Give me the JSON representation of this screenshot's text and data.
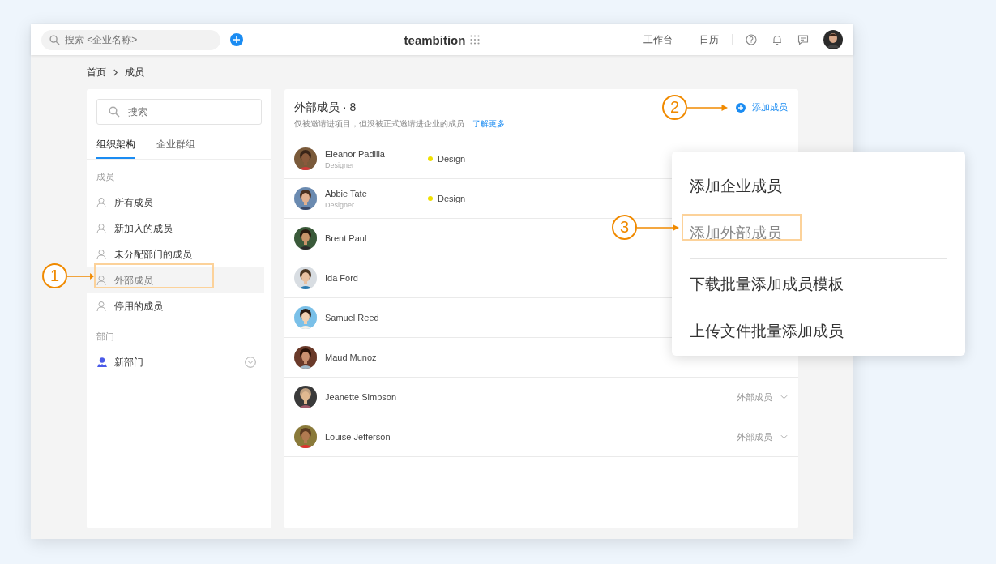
{
  "topbar": {
    "search": {
      "placeholder": "搜索 <企业名称>"
    },
    "logo": "teambition",
    "nav": [
      "工作台",
      "日历"
    ]
  },
  "breadcrumb": [
    "首页",
    "成员"
  ],
  "sidebar": {
    "search": {
      "placeholder": "搜索"
    },
    "tabs": [
      {
        "label": "组织架构",
        "selected": true
      },
      {
        "label": "企业群组",
        "selected": false
      }
    ],
    "sections": [
      {
        "heading": "成员",
        "items": [
          {
            "label": "所有成员",
            "selected": false
          },
          {
            "label": "新加入的成员",
            "selected": false
          },
          {
            "label": "未分配部门的成员",
            "selected": false
          },
          {
            "label": "外部成员",
            "selected": true
          },
          {
            "label": "停用的成员",
            "selected": false
          }
        ]
      },
      {
        "heading": "部门",
        "items": [
          {
            "label": "新部门",
            "selected": false,
            "expandable": true
          }
        ]
      }
    ]
  },
  "members": {
    "title": "外部成员 · 8",
    "description": "仅被邀请进项目，但没被正式邀请进企业的成员",
    "link": "了解更多",
    "add_button": "添加成员",
    "rows": [
      {
        "name": "Eleanor Padilla",
        "title": "Designer",
        "dept": {
          "label": "Design",
          "color": "#f0e000"
        }
      },
      {
        "name": "Abbie Tate",
        "title": "Designer",
        "dept": {
          "label": "Design",
          "color": "#f0e000"
        }
      },
      {
        "name": "Brent Paul"
      },
      {
        "name": "Ida Ford"
      },
      {
        "name": "Samuel Reed"
      },
      {
        "name": "Maud Munoz"
      },
      {
        "name": "Jeanette Simpson",
        "role": "外部成员"
      },
      {
        "name": "Louise Jefferson",
        "role": "外部成员"
      }
    ]
  },
  "menu": {
    "groups": [
      [
        {
          "label": "添加企业成员",
          "selected": false
        },
        {
          "label": "添加外部成员",
          "selected": true
        }
      ],
      [
        {
          "label": "下载批量添加成员模板",
          "selected": false
        },
        {
          "label": "上传文件批量添加成员",
          "selected": false
        }
      ]
    ]
  },
  "annotations": [
    {
      "number": "1"
    },
    {
      "number": "2"
    },
    {
      "number": "3"
    }
  ]
}
